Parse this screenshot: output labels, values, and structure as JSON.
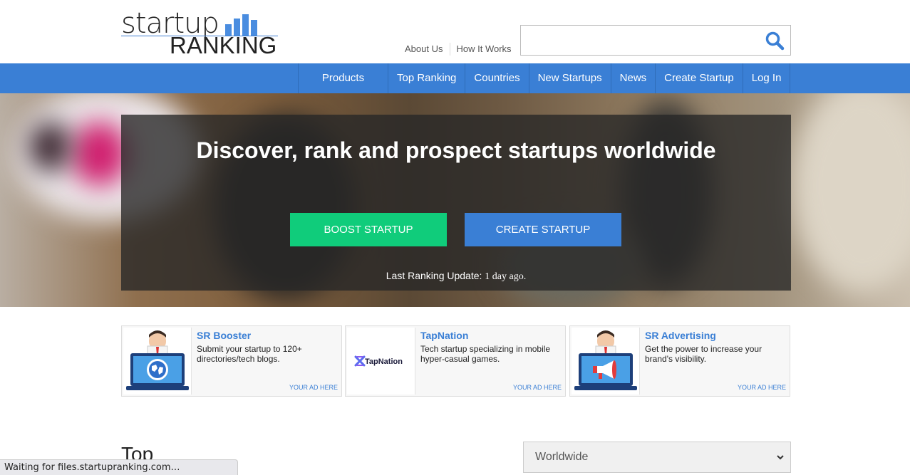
{
  "header": {
    "logo_top": "startup",
    "logo_bottom": "RANKING",
    "top_links": [
      "About Us",
      "How It Works"
    ],
    "search": {
      "value": "",
      "placeholder": ""
    },
    "search_icon": "search-icon"
  },
  "nav": {
    "items": [
      "Products",
      "Top Ranking",
      "Countries",
      "New Startups",
      "News",
      "Create Startup",
      "Log In"
    ]
  },
  "hero": {
    "title": "Discover, rank and prospect startups worldwide",
    "boost_button": "BOOST STARTUP",
    "create_button": "CREATE STARTUP",
    "last_update_label": "Last Ranking Update:",
    "last_update_value": "1 day ago."
  },
  "ads": [
    {
      "title": "SR Booster",
      "description": "Submit your startup to 120+ directories/tech blogs.",
      "note": "YOUR AD HERE",
      "icon": "laptop-globe-icon"
    },
    {
      "title": "TapNation",
      "description": "Tech startup specializing in mobile hyper-casual games.",
      "note": "YOUR AD HERE",
      "icon": "tapnation-logo",
      "logo_text": "TapNation"
    },
    {
      "title": "SR Advertising",
      "description": "Get the power to increase your brand's visibility.",
      "note": "YOUR AD HERE",
      "icon": "laptop-megaphone-icon"
    }
  ],
  "section": {
    "title": "Top",
    "region_select": {
      "value": "Worldwide"
    }
  },
  "status_bar": "Waiting for files.startupranking.com…",
  "colors": {
    "brand_blue": "#3a7fd5",
    "boost_green": "#10cc7b"
  }
}
